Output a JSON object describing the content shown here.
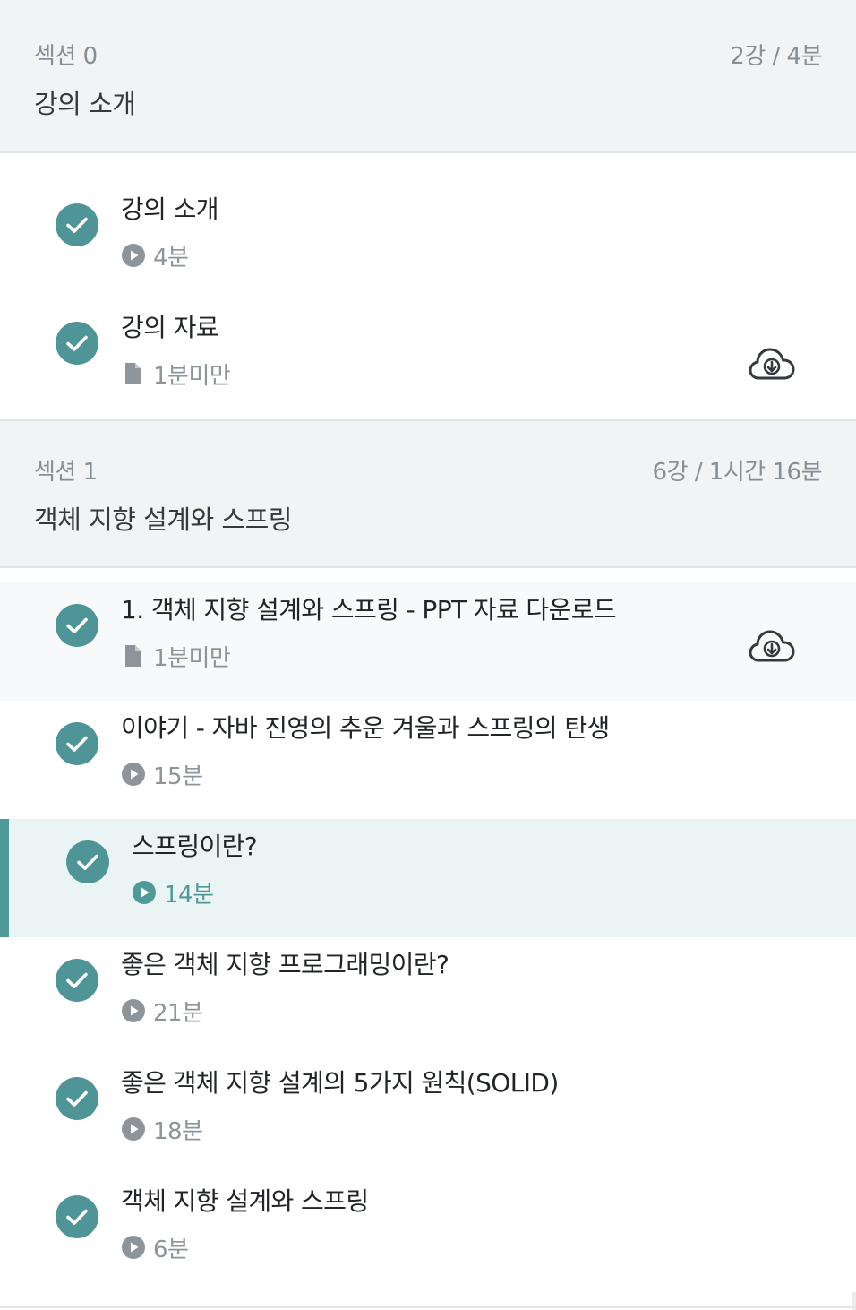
{
  "sections": [
    {
      "number_label": "섹션 0",
      "meta": "2강 / 4분",
      "title": "강의 소개",
      "lessons": [
        {
          "title": "강의 소개",
          "type": "video",
          "duration": "4분",
          "completed": true,
          "download": false,
          "state": "normal"
        },
        {
          "title": "강의 자료",
          "type": "document",
          "duration": "1분미만",
          "completed": true,
          "download": true,
          "state": "normal"
        }
      ]
    },
    {
      "number_label": "섹션 1",
      "meta": "6강 / 1시간 16분",
      "title": "객체 지향 설계와 스프링",
      "lessons": [
        {
          "title": "1. 객체 지향 설계와 스프링 - PPT 자료 다운로드",
          "type": "document",
          "duration": "1분미만",
          "completed": true,
          "download": true,
          "state": "hover"
        },
        {
          "title": "이야기 - 자바 진영의 추운 겨울과 스프링의 탄생",
          "type": "video",
          "duration": "15분",
          "completed": true,
          "download": false,
          "state": "normal"
        },
        {
          "title": "스프링이란?",
          "type": "video",
          "duration": "14분",
          "completed": true,
          "download": false,
          "state": "active"
        },
        {
          "title": "좋은 객체 지향 프로그래밍이란?",
          "type": "video",
          "duration": "21분",
          "completed": true,
          "download": false,
          "state": "normal"
        },
        {
          "title": "좋은 객체 지향 설계의 5가지 원칙(SOLID)",
          "type": "video",
          "duration": "18분",
          "completed": true,
          "download": false,
          "state": "normal"
        },
        {
          "title": "객체 지향 설계와 스프링",
          "type": "video",
          "duration": "6분",
          "completed": true,
          "download": false,
          "state": "normal"
        }
      ]
    }
  ],
  "colors": {
    "accent": "#4f9598",
    "active_bg": "#eaf4f4",
    "section_bg": "#f1f3f5",
    "muted_text": "#868e96"
  },
  "icons": {
    "check": "check-circle-icon",
    "video": "play-circle-icon",
    "document": "file-icon",
    "download": "cloud-download-icon"
  }
}
